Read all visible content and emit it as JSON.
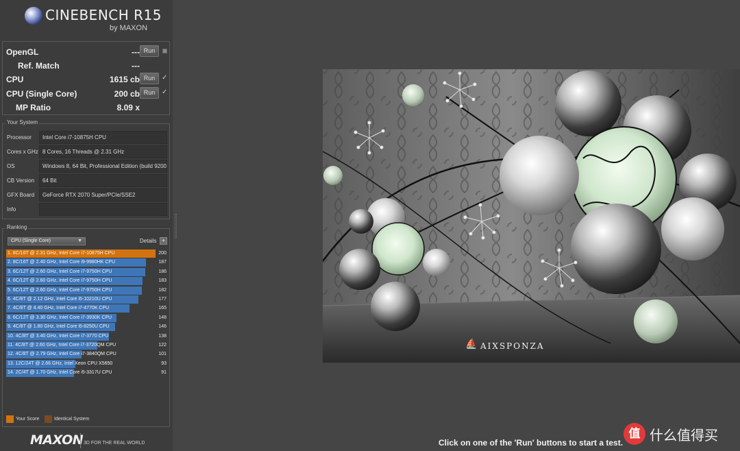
{
  "app": {
    "title": "CINEBENCH R15",
    "subtitle": "by MAXON"
  },
  "scores": [
    {
      "label": "OpenGL",
      "value": "---",
      "run": "Run",
      "mark": "box"
    },
    {
      "label": "Ref. Match",
      "value": "---"
    },
    {
      "label": "CPU",
      "value": "1615 cb",
      "run": "Run",
      "mark": "check"
    },
    {
      "label": "CPU (Single Core)",
      "value": "200 cb",
      "run": "Run",
      "mark": "check"
    },
    {
      "label": "MP Ratio",
      "value": "8.09 x"
    }
  ],
  "check_glyph": "✓",
  "system": {
    "title": "Your System",
    "rows": [
      {
        "label": "Processor",
        "value": "Intel Core i7-10875H CPU"
      },
      {
        "label": "Cores x GHz",
        "value": "8 Cores, 16 Threads @ 2.31 GHz"
      },
      {
        "label": "OS",
        "value": "Windows 8, 64 Bit, Professional Edition (build 9200)"
      },
      {
        "label": "CB Version",
        "value": "64 Bit"
      },
      {
        "label": "GFX Board",
        "value": "GeForce RTX 2070 Super/PCIe/SSE2"
      },
      {
        "label": "Info",
        "value": ""
      }
    ]
  },
  "ranking": {
    "title": "Ranking",
    "selected": "CPU (Single Core)",
    "details_label": "Details",
    "details_button": "+",
    "max_score": 200,
    "entries": [
      {
        "label": "1. 8C/16T @ 2.31 GHz, Intel Core i7-10875H CPU",
        "score": 200,
        "mine": true
      },
      {
        "label": "2. 8C/16T @ 2.40 GHz, Intel Core i9-9980HK CPU",
        "score": 187
      },
      {
        "label": "3. 6C/12T @ 2.60 GHz, Intel Core i7-9750H CPU",
        "score": 186
      },
      {
        "label": "4. 6C/12T @ 2.60 GHz, Intel Core i7-9750H CPU",
        "score": 183
      },
      {
        "label": "5. 6C/12T @ 2.60 GHz, Intel Core i7-9750H CPU",
        "score": 182
      },
      {
        "label": "6. 4C/8T @ 2.12 GHz, Intel Core i5-10210U CPU",
        "score": 177
      },
      {
        "label": "7. 4C/8T @ 4.40 GHz, Intel Core i7-4770K CPU",
        "score": 165
      },
      {
        "label": "8. 6C/12T @ 3.30 GHz,  Intel Core i7-3930K CPU",
        "score": 148
      },
      {
        "label": "9. 4C/8T @ 1.80 GHz, Intel Core i5-8250U CPU",
        "score": 146
      },
      {
        "label": "10. 4C/8T @ 3.40 GHz,  Intel Core i7-3770 CPU",
        "score": 138
      },
      {
        "label": "11. 4C/8T @ 2.60 GHz, Intel Core i7-3720QM CPU",
        "score": 122
      },
      {
        "label": "12. 4C/8T @ 2.79 GHz, Intel Core i7-3840QM CPU",
        "score": 101
      },
      {
        "label": "13. 12C/24T @ 2.66 GHz, Intel Xeon CPU X5650",
        "score": 93
      },
      {
        "label": "14. 2C/4T @ 1.70 GHz,  Intel Core i5-3317U CPU",
        "score": 91
      }
    ],
    "legend": [
      {
        "label": "Your Score",
        "color": "#d2730f"
      },
      {
        "label": "Identical System",
        "color": "#7a4a22"
      }
    ]
  },
  "footer": {
    "brand": "MAXON",
    "tagline": "3D FOR THE REAL WORLD"
  },
  "render": {
    "logo_text": "AIXSPONZA"
  },
  "status": "Click on one of the 'Run' buttons to start a test.",
  "watermark": {
    "badge": "值",
    "text": "什么值得买"
  },
  "colors": {
    "your_score": "#d2730f",
    "bar": "#3e76b8",
    "identical": "#7a4a22",
    "background": "#454545"
  }
}
